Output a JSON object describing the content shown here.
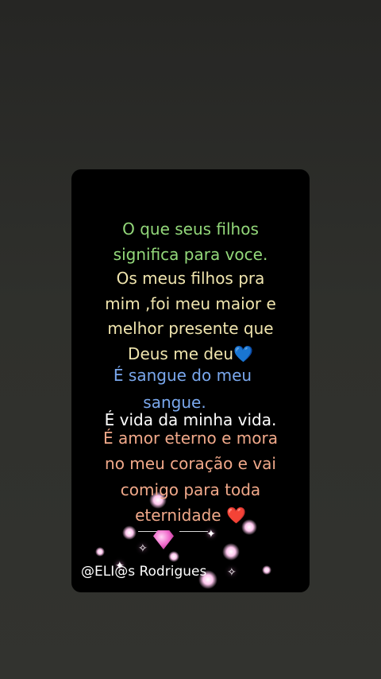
{
  "post": {
    "lines": [
      "O que seus filhos",
      "significa para voce.",
      "Os meus filhos pra",
      "mim ,foi meu maior e",
      "melhor presente que",
      "Deus me deu",
      "É sangue do meu",
      "sangue.",
      "É vida da minha vida.",
      "É amor eterno e mora",
      "no meu coração e vai",
      "comigo para toda",
      "eternidade"
    ],
    "emoji_blue_heart": "💙",
    "emoji_red_heart": "❤️",
    "credit": "@ELI@s Rodrigues"
  },
  "colors": {
    "question": "#93d87a",
    "answer": "#f0e5ae",
    "blood": "#7aa8ee",
    "life": "#ffffff",
    "love": "#f1a98a"
  },
  "icons": [
    "blue-heart-icon",
    "red-heart-icon",
    "sparkle-decoration",
    "diamond-gem-icon"
  ]
}
